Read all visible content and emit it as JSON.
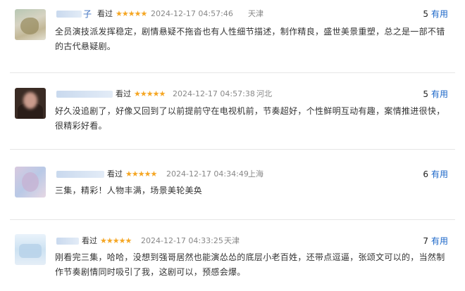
{
  "reviews": [
    {
      "name_visible": "子",
      "watched": "看过",
      "stars": "★★★★★",
      "time": "2024-12-17 04:57:46",
      "location": "天津",
      "useful_count": "5",
      "useful_label": "有用",
      "content": "全员演技派发挥稳定，剧情悬疑不拖沓也有人性细节描述，制作精良，盛世美景重塑，总之是一部不错的古代悬疑剧。"
    },
    {
      "name_visible": "",
      "watched": "看过",
      "stars": "★★★★★",
      "time": "2024-12-17 04:57:38",
      "location": "河北",
      "useful_count": "5",
      "useful_label": "有用",
      "content": "好久没追剧了，好像又回到了以前提前守在电视机前，节奏超好，个性鲜明互动有趣，案情推进很快，很精彩好看。"
    },
    {
      "name_visible": "",
      "watched": "看过",
      "stars": "★★★★★",
      "time": "2024-12-17 04:34:49",
      "location": "上海",
      "useful_count": "6",
      "useful_label": "有用",
      "content": "三集，精彩！人物丰满，场景美轮美奂"
    },
    {
      "name_visible": "",
      "watched": "看过",
      "stars": "★★★★★",
      "time": "2024-12-17 04:33:25",
      "location": "天津",
      "useful_count": "7",
      "useful_label": "有用",
      "content": "刚看完三集，哈哈，没想到强哥居然也能演怂怂的底层小老百姓，还带点逗逼，张颂文可以的，当然制作节奏剧情同时吸引了我，这剧可以，预感会爆。"
    }
  ]
}
